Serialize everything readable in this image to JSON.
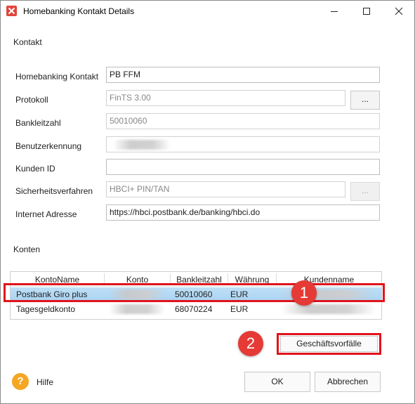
{
  "window": {
    "title": "Homebanking Kontakt Details",
    "icons": {
      "app": "app-x-icon",
      "minimize": "minimize-icon",
      "maximize": "maximize-icon",
      "close": "close-icon"
    }
  },
  "kontakt": {
    "section_label": "Kontakt",
    "fields": {
      "homebanking_kontakt": {
        "label": "Homebanking Kontakt",
        "value": "PB FFM"
      },
      "protokoll": {
        "label": "Protokoll",
        "value": "FinTS 3.00",
        "button": "..."
      },
      "bankleitzahl": {
        "label": "Bankleitzahl",
        "value": "50010060"
      },
      "benutzerkennung": {
        "label": "Benutzerkennung",
        "value": ""
      },
      "kunden_id": {
        "label": "Kunden ID",
        "value": ""
      },
      "sicherheitsverfahren": {
        "label": "Sicherheitsverfahren",
        "value": "HBCI+ PIN/TAN",
        "button": "..."
      },
      "internet_adresse": {
        "label": "Internet Adresse",
        "value": "https://hbci.postbank.de/banking/hbci.do"
      }
    }
  },
  "konten": {
    "section_label": "Konten",
    "columns": [
      "KontoName",
      "Konto",
      "Bankleitzahl",
      "Währung",
      "Kundenname"
    ],
    "rows": [
      {
        "kontoname": "Postbank Giro plus",
        "konto": "",
        "bankleitzahl": "50010060",
        "waehrung": "EUR",
        "kundenname": "",
        "selected": true
      },
      {
        "kontoname": "Tagesgeldkonto",
        "konto": "",
        "bankleitzahl": "68070224",
        "waehrung": "EUR",
        "kundenname": "",
        "selected": false
      }
    ]
  },
  "annotations": {
    "badge1": "1",
    "badge2": "2",
    "color": "#e0141c"
  },
  "buttons": {
    "geschaeftsvorfaelle": "Geschäftsvorfälle",
    "ok": "OK",
    "abbrechen": "Abbrechen",
    "hilfe": "Hilfe",
    "help_icon_glyph": "?"
  }
}
